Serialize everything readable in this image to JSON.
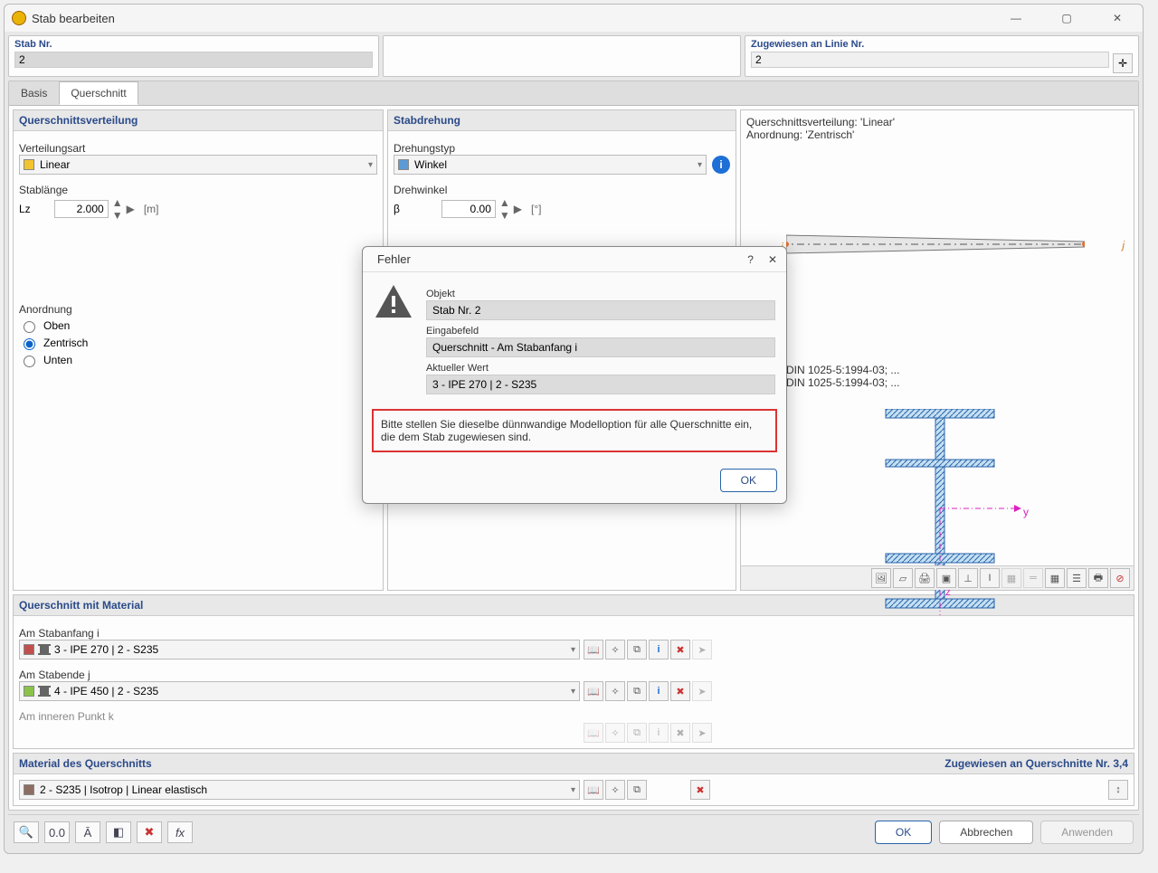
{
  "window": {
    "title": "Stab bearbeiten"
  },
  "header": {
    "stab_nr_label": "Stab Nr.",
    "stab_nr_value": "2",
    "assigned_label": "Zugewiesen an Linie Nr.",
    "assigned_value": "2"
  },
  "tabs": {
    "basis": "Basis",
    "querschnitt": "Querschnitt"
  },
  "qsv": {
    "title": "Querschnittsverteilung",
    "verteilungsart_label": "Verteilungsart",
    "verteilungsart_value": "Linear",
    "stablange_label": "Stablänge",
    "stablange_sym": "Lz",
    "stablange_value": "2.000",
    "stablange_unit": "[m]",
    "anordnung_label": "Anordnung",
    "anordnung_opts": {
      "oben": "Oben",
      "zentrisch": "Zentrisch",
      "unten": "Unten"
    }
  },
  "rotation": {
    "title": "Stabdrehung",
    "drehungstyp_label": "Drehungstyp",
    "drehungstyp_value": "Winkel",
    "drehwinkel_label": "Drehwinkel",
    "drehwinkel_sym": "β",
    "drehwinkel_value": "0.00",
    "drehwinkel_unit": "[°]"
  },
  "preview": {
    "line1": "Querschnittsverteilung: 'Linear'",
    "line2": "Anordnung: 'Zentrisch'",
    "line3": "DIN 1025-5:1994-03; ...",
    "line4": "DIN 1025-5:1994-03; ...",
    "node_i": "i",
    "node_j": "j",
    "axis_y": "y",
    "axis_z": "z"
  },
  "qs_material": {
    "title": "Querschnitt mit Material",
    "start_label": "Am Stabanfang i",
    "start_value": "3 - IPE 270 | 2 - S235",
    "end_label": "Am Stabende j",
    "end_value": "4 - IPE 450 | 2 - S235",
    "inner_label": "Am inneren Punkt k"
  },
  "material": {
    "title": "Material des Querschnitts",
    "assigned": "Zugewiesen an Querschnitte Nr. 3,4",
    "value": "2 - S235 | Isotrop | Linear elastisch"
  },
  "footer": {
    "ok": "OK",
    "cancel": "Abbrechen",
    "apply": "Anwenden"
  },
  "error": {
    "title": "Fehler",
    "help": "?",
    "close": "✕",
    "objekt_label": "Objekt",
    "objekt_value": "Stab Nr. 2",
    "eingabefeld_label": "Eingabefeld",
    "eingabefeld_value": "Querschnitt - Am Stabanfang i",
    "aktueller_label": "Aktueller Wert",
    "aktueller_value": "3 - IPE 270 | 2 - S235",
    "message": "Bitte stellen Sie dieselbe dünnwandige Modelloption für alle Querschnitte ein, die dem Stab zugewiesen sind.",
    "ok": "OK"
  }
}
